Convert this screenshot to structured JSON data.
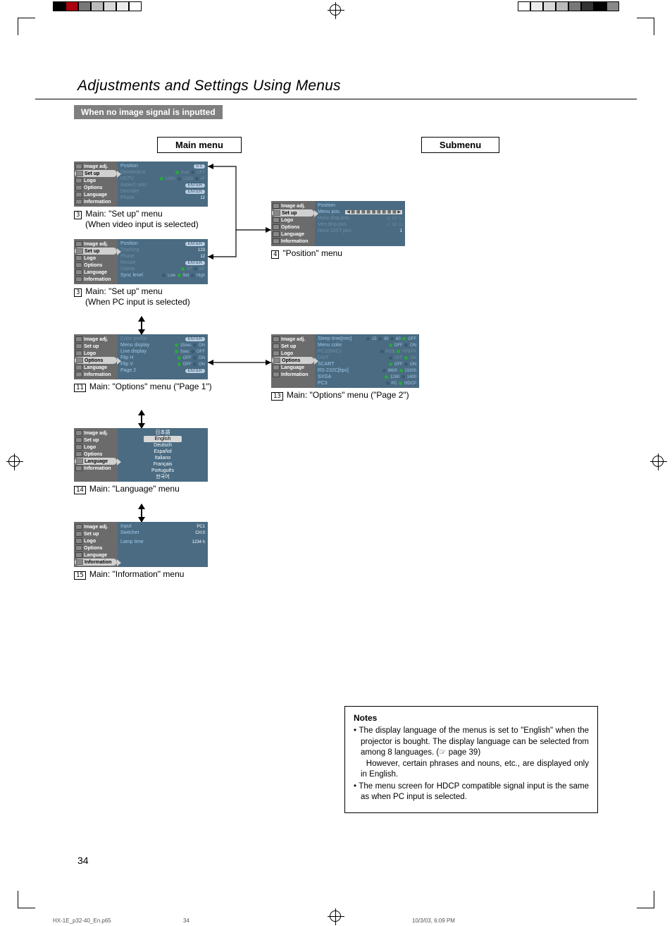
{
  "title": "Adjustments and Settings Using Menus",
  "section_header": "When no image signal is inputted",
  "columns": {
    "main": "Main menu",
    "sub": "Submenu"
  },
  "side_items": [
    "Image adj.",
    "Set up",
    "Logo",
    "Options",
    "Language",
    "Information"
  ],
  "menu1": {
    "rows": [
      {
        "lab": "Position",
        "val": "",
        "pill": "0   0"
      },
      {
        "lab": "Deinterlace",
        "opts": [
          "Auto",
          "OFF"
        ],
        "dim": true,
        "sel": 0
      },
      {
        "lab": "HDTV",
        "opts": [
          "1080i",
          "1035i",
          "xF"
        ],
        "dim": true,
        "sel": 0
      },
      {
        "lab": "Aspect ratio",
        "pill": "ENTER",
        "dim": true
      },
      {
        "lab": "Decoder",
        "pill": "ENTER",
        "dim": true
      },
      {
        "lab": "Phase",
        "val": "12",
        "dim": true
      }
    ]
  },
  "caption1": {
    "num": "3",
    "text": "Main: \"Set up\" menu",
    "sub": "(When video input is selected)"
  },
  "menu2": {
    "rows": [
      {
        "lab": "Position",
        "pill": "ENTER"
      },
      {
        "lab": "Tracking",
        "val": "123",
        "dim": true
      },
      {
        "lab": "Phase",
        "val": "12",
        "dim": true
      },
      {
        "lab": "Resize",
        "pill": "ENTER",
        "dim": true
      },
      {
        "lab": "Clamp",
        "opts": [
          "ST",
          "BP"
        ],
        "dim": true,
        "sel": 0
      },
      {
        "lab": "Sync level",
        "opts": [
          "Low",
          "Std",
          "High"
        ],
        "sel": 1
      }
    ]
  },
  "caption2": {
    "num": "3",
    "text": "Main: \"Set up\" menu",
    "sub": "(When PC input is selected)"
  },
  "menu_position": {
    "rows": [
      {
        "lab": "Position"
      },
      {
        "lab": "Menu pos.",
        "icons": true
      },
      {
        "lab": "Horiz.disp.pos.",
        "val": "12",
        "arrows": true,
        "dim": true
      },
      {
        "lab": "Vert.disp.pos.",
        "val": "12",
        "arrows": true,
        "dim": true
      },
      {
        "lab": "Horiz.DIST pos.",
        "val": "1",
        "dim": true
      }
    ]
  },
  "caption_position": {
    "num": "4",
    "text": "\"Position\" menu"
  },
  "menu_options1": {
    "rows": [
      {
        "lab": "Color profile",
        "pill": "ENTER",
        "dim": true
      },
      {
        "lab": "Menu display",
        "opts": [
          "15sec",
          "ON"
        ],
        "sel": 0
      },
      {
        "lab": "Line display",
        "opts": [
          "5sec",
          "OFF"
        ],
        "sel": 0
      },
      {
        "lab": "Flip H",
        "opts": [
          "OFF",
          "ON"
        ],
        "sel": 0
      },
      {
        "lab": "Flip V",
        "opts": [
          "OFF",
          "ON"
        ],
        "sel": 0
      },
      {
        "lab": "Page 2",
        "pill": "ENTER"
      }
    ]
  },
  "caption_options1": {
    "num": "11",
    "text": "Main: \"Options\" menu (\"Page 1\")"
  },
  "menu_options2": {
    "rows": [
      {
        "lab": "Sleep time[min]",
        "opts": [
          "15",
          "30",
          "60",
          "OFF"
        ],
        "sel": 3
      },
      {
        "lab": "Menu color",
        "opts": [
          "OFF",
          "ON"
        ],
        "sel": 0
      },
      {
        "lab": "PC2(BNC)",
        "opts": [
          "RGB",
          "YPBPR"
        ],
        "sel": 1,
        "dim": true
      },
      {
        "lab": "DIST",
        "opts": [
          "OFF",
          "ON"
        ],
        "sel": 1,
        "dim": true
      },
      {
        "lab": "SCART",
        "opts": [
          "OFF",
          "ON"
        ],
        "sel": 0
      },
      {
        "lab": "RS-232C[bps]",
        "opts": [
          "9600",
          "19200"
        ],
        "sel": 1
      },
      {
        "lab": "SXGA",
        "opts": [
          "1280",
          "1400"
        ],
        "sel": 0
      },
      {
        "lab": "PC3",
        "opts": [
          "PC",
          "HDCP"
        ],
        "sel": 1
      }
    ]
  },
  "caption_options2": {
    "num": "13",
    "text": "Main: \"Options\" menu (\"Page 2\")"
  },
  "languages": [
    "日本語",
    "English",
    "Deutsch",
    "Español",
    "Italiano",
    "Français",
    "Português",
    "한국어"
  ],
  "caption_language": {
    "num": "14",
    "text": "Main: \"Language\" menu"
  },
  "menu_info": {
    "rows": [
      {
        "lab": "Input",
        "val": "PC1"
      },
      {
        "lab": "Switcher",
        "val": "CH:0"
      },
      {
        "lab": "",
        "val": ""
      },
      {
        "lab": "",
        "val": ""
      },
      {
        "lab": "Lamp time",
        "val": "1234 h"
      }
    ]
  },
  "caption_info": {
    "num": "15",
    "text": "Main: \"Information\" menu"
  },
  "notes": {
    "heading": "Notes",
    "items": [
      "The display language of the menus is set to \"English\" when the projector is bought. The display language can be selected from among 8 languages. (☞ page 39)\nHowever, certain phrases and nouns, etc., are displayed only in English.",
      "The menu screen for HDCP compatible signal input is the same as when PC input is selected."
    ]
  },
  "page_number": "34",
  "footer": {
    "file": "HX-1E_p32-40_En.p65",
    "pg": "34",
    "ts": "10/3/03, 6:09 PM"
  },
  "swatches_left": [
    "#000",
    "#ab0010",
    "#777",
    "#bbb",
    "#d9d9d9",
    "#ededed",
    "#fff"
  ],
  "swatches_right": [
    "#fff",
    "#ededed",
    "#d9d9d9",
    "#bbb",
    "#777",
    "#333",
    "#000",
    "#888"
  ]
}
